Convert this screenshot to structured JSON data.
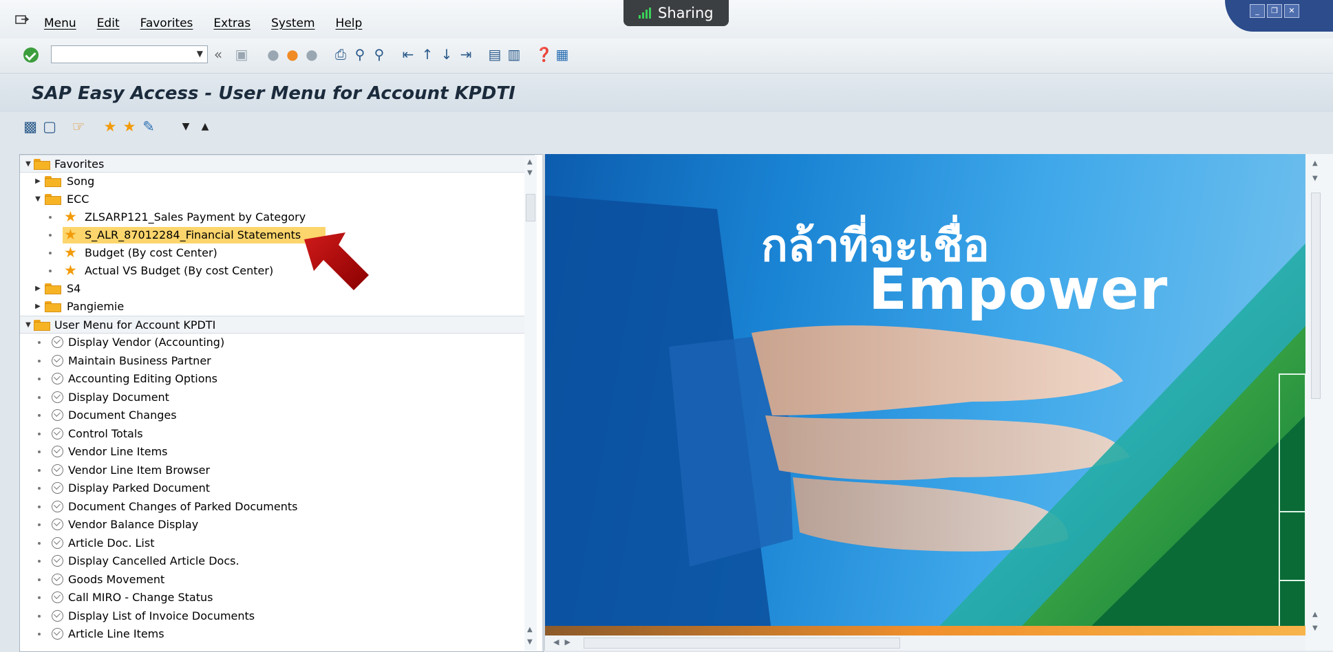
{
  "menubar": {
    "items": [
      "Menu",
      "Edit",
      "Favorites",
      "Extras",
      "System",
      "Help"
    ]
  },
  "sharing": {
    "label": "Sharing"
  },
  "toolbar": {
    "command_field_value": ""
  },
  "title": "SAP Easy Access  -  User Menu for Account KPDTI",
  "tree": {
    "favorites_label": "Favorites",
    "song_label": "Song",
    "ecc_label": "ECC",
    "ecc_items": [
      "ZLSARP121_Sales Payment by Category",
      "S_ALR_87012284_Financial Statements",
      "Budget (By cost Center)",
      "Actual VS Budget (By cost Center)"
    ],
    "s4_label": "S4",
    "pangiemie_label": "Pangiemie",
    "user_menu_label": "User Menu for Account KPDTI",
    "user_menu_items": [
      "Display Vendor (Accounting)",
      "Maintain Business Partner",
      "Accounting Editing Options",
      "Display Document",
      "Document Changes",
      "Control Totals",
      "Vendor Line Items",
      "Vendor Line Item Browser",
      "Display Parked Document",
      "Document Changes of Parked Documents",
      "Vendor Balance Display",
      "Article Doc. List",
      "Display Cancelled Article Docs.",
      "Goods Movement",
      "Call MIRO - Change Status",
      "Display List of Invoice Documents",
      "Article Line Items"
    ]
  },
  "banner": {
    "thai_text": "กล้าที่จะเชื่อ",
    "headline": "Empower"
  },
  "colors": {
    "selected_highlight": "#fcd56c",
    "folder": "#f6b425",
    "star": "#f29b0a",
    "annotation_arrow": "#b00000"
  }
}
